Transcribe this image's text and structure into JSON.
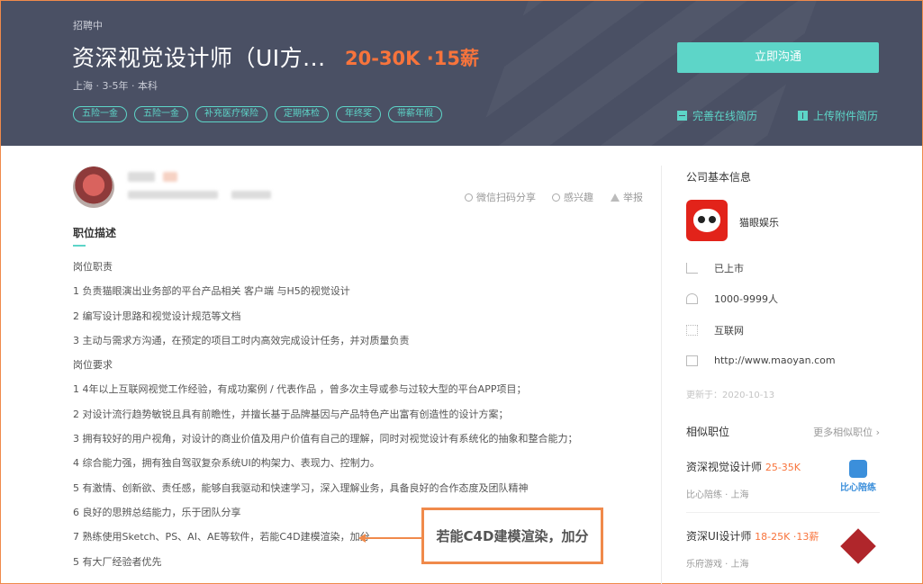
{
  "header": {
    "status": "招聘中",
    "title": "资深视觉设计师（UI方...",
    "salary": "20-30K ·15薪",
    "meta": "上海 · 3-5年 · 本科",
    "tags": [
      "五险一金",
      "五险一金",
      "补充医疗保险",
      "定期体检",
      "年终奖",
      "带薪年假"
    ],
    "chat_button": "立即沟通",
    "improve_resume": "完善在线简历",
    "upload_resume": "上传附件简历"
  },
  "actions": {
    "share": "微信扫码分享",
    "interest": "感兴趣",
    "report": "举报"
  },
  "description": {
    "title": "职位描述",
    "lines": [
      "岗位职责",
      "1 负责猫眼演出业务部的平台产品相关 客户端 与H5的视觉设计",
      "2 编写设计思路和视觉设计规范等文档",
      "3 主动与需求方沟通，在预定的项目工时内高效完成设计任务，并对质量负责",
      "岗位要求",
      "1 4年以上互联网视觉工作经验，有成功案例 / 代表作品 ，曾多次主导或参与过较大型的平台APP项目；",
      "2 对设计流行趋势敏锐且具有前瞻性，并擅长基于品牌基因与产品特色产出富有创造性的设计方案；",
      "3 拥有较好的用户视角，对设计的商业价值及用户价值有自己的理解，同时对视觉设计有系统化的抽象和整合能力；",
      "4 综合能力强，拥有独自驾驭复杂系统UI的构架力、表现力、控制力。",
      "5 有激情、创新欲、责任感，能够自我驱动和快速学习，深入理解业务，具备良好的合作态度及团队精神",
      "6 良好的思辨总结能力，乐于团队分享",
      "7 熟练使用Sketch、PS、AI、AE等软件，若能C4D建模渲染，加分",
      "5 有大厂经验者优先"
    ],
    "callout": "若能C4D建模渲染，加分"
  },
  "company": {
    "section_title": "公司基本信息",
    "name": "猫眼娱乐",
    "stage": "已上市",
    "size": "1000-9999人",
    "industry": "互联网",
    "website": "http://www.maoyan.com",
    "updated": "更新于：2020-10-13"
  },
  "related": {
    "title": "相似职位",
    "more": "更多相似职位",
    "items": [
      {
        "name": "资深视觉设计师",
        "salary": "25-35K",
        "company": "比心陪练",
        "city": "上海",
        "logo_text": "比心陪练"
      },
      {
        "name": "资深UI设计师",
        "salary": "18-25K ·13薪",
        "company": "乐府游戏",
        "city": "上海"
      }
    ]
  },
  "colors": {
    "accent": "#5dd5c8",
    "salary": "#f8743c",
    "header_bg": "#4a5064",
    "callout_border": "#f08a4b"
  }
}
